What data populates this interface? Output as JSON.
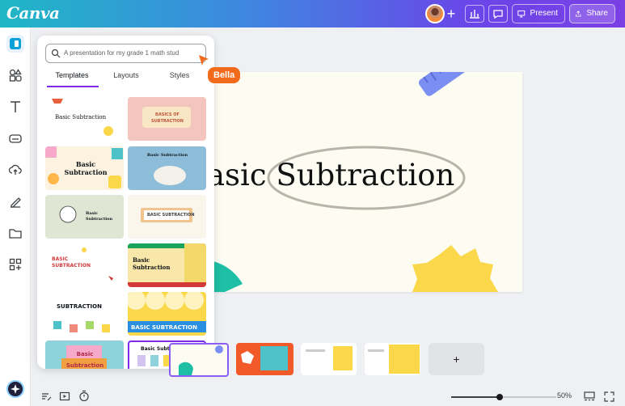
{
  "app": {
    "logo": "Canva"
  },
  "topbar": {
    "present_label": "Present",
    "share_label": "Share",
    "add_icon": "plus-icon",
    "analytics_icon": "bar-chart-icon",
    "comment_icon": "comment-icon"
  },
  "rail": {
    "items": [
      "design-icon",
      "elements-icon",
      "text-icon",
      "brand-icon",
      "uploads-icon",
      "draw-icon",
      "projects-icon",
      "apps-icon"
    ]
  },
  "panel": {
    "search_placeholder": "A presentation for my grade 1 math stud",
    "tabs": [
      "Templates",
      "Layouts",
      "Styles"
    ],
    "active_tab": "Templates"
  },
  "templates": [
    {
      "title": "Basic Subtraction"
    },
    {
      "title": "BASICS OF SUBTRACTION"
    },
    {
      "title": "Basic Subtraction"
    },
    {
      "title": "Basic Subtraction"
    },
    {
      "title": "Basic Subtraction"
    },
    {
      "title": "BASIC SUBTRACTION"
    },
    {
      "title": "BASIC SUBTRACTION"
    },
    {
      "title": "Basic Subtraction"
    },
    {
      "title": "SUBTRACTION"
    },
    {
      "title": "BASIC SUBTRACTION"
    },
    {
      "title": "Basic Subtraction"
    },
    {
      "title": "Basic Subtraction"
    }
  ],
  "collaborator": {
    "name": "Bella"
  },
  "slide": {
    "title": "asic Subtraction"
  },
  "filmstrip": {
    "add_label": "+"
  },
  "bottom": {
    "zoom": "50%"
  }
}
